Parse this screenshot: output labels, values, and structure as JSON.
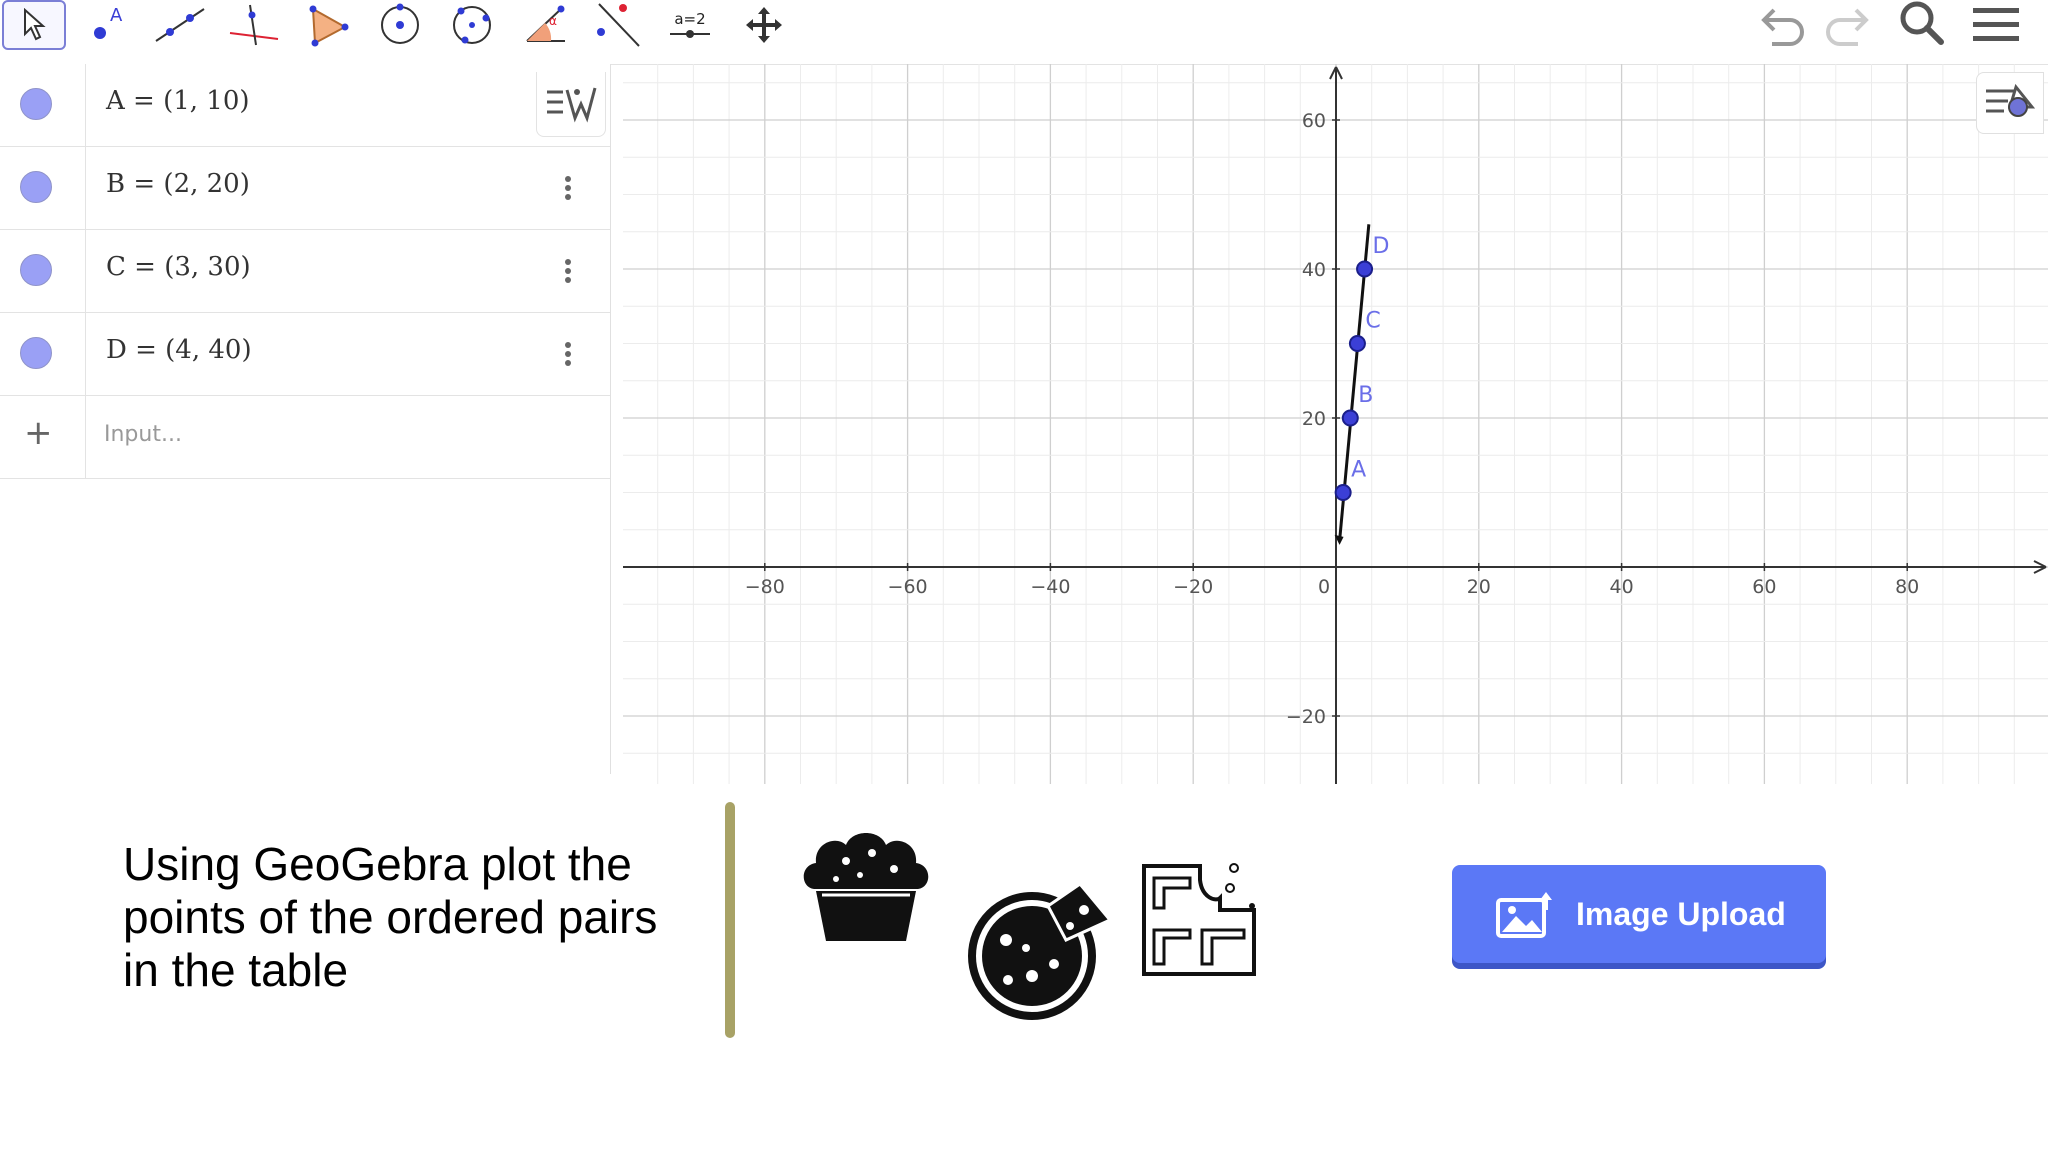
{
  "toolbar": {
    "tools": [
      {
        "name": "move-tool",
        "icon": "cursor-arrow-icon"
      },
      {
        "name": "point-tool",
        "icon": "point-a-icon",
        "label": "A"
      },
      {
        "name": "line-tool",
        "icon": "line-through-points-icon"
      },
      {
        "name": "perpendicular-line-tool",
        "icon": "perpendicular-icon"
      },
      {
        "name": "polygon-tool",
        "icon": "triangle-icon"
      },
      {
        "name": "circle-center-tool",
        "icon": "circle-center-icon"
      },
      {
        "name": "circle-three-points-tool",
        "icon": "circle-points-icon"
      },
      {
        "name": "angle-tool",
        "icon": "angle-icon"
      },
      {
        "name": "reflect-tool",
        "icon": "reflect-icon"
      },
      {
        "name": "slider-tool",
        "icon": "slider-icon",
        "label": "a=2"
      },
      {
        "name": "move-graphics-tool",
        "icon": "move-arrows-icon"
      }
    ],
    "right": [
      "undo-icon",
      "redo-icon",
      "search-icon",
      "menu-icon"
    ]
  },
  "algebra": {
    "rows": [
      {
        "expr": "A = (1, 10)"
      },
      {
        "expr": "B = (2, 20)"
      },
      {
        "expr": "C = (3, 30)"
      },
      {
        "expr": "D = (4, 40)"
      }
    ],
    "input_placeholder": "Input..."
  },
  "graph": {
    "x_ticks": [
      "−80",
      "−60",
      "−40",
      "−20",
      "0",
      "20",
      "40",
      "60",
      "80"
    ],
    "y_ticks": [
      "60",
      "40",
      "20",
      "−20"
    ],
    "points": [
      {
        "label": "A",
        "x": 1,
        "y": 10
      },
      {
        "label": "B",
        "x": 2,
        "y": 20
      },
      {
        "label": "C",
        "x": 3,
        "y": 30
      },
      {
        "label": "D",
        "x": 4,
        "y": 40
      }
    ],
    "point_color": "#3b3fd6",
    "label_color": "#6a6ee8"
  },
  "caption": "Using GeoGebra plot the points of the ordered pairs in the table",
  "upload_button": {
    "label": "Image Upload",
    "icon": "image-upload-icon",
    "color": "#5b78f6"
  },
  "food_icons": [
    "cupcake-icon",
    "pizza-icon",
    "chocolate-bar-icon"
  ]
}
